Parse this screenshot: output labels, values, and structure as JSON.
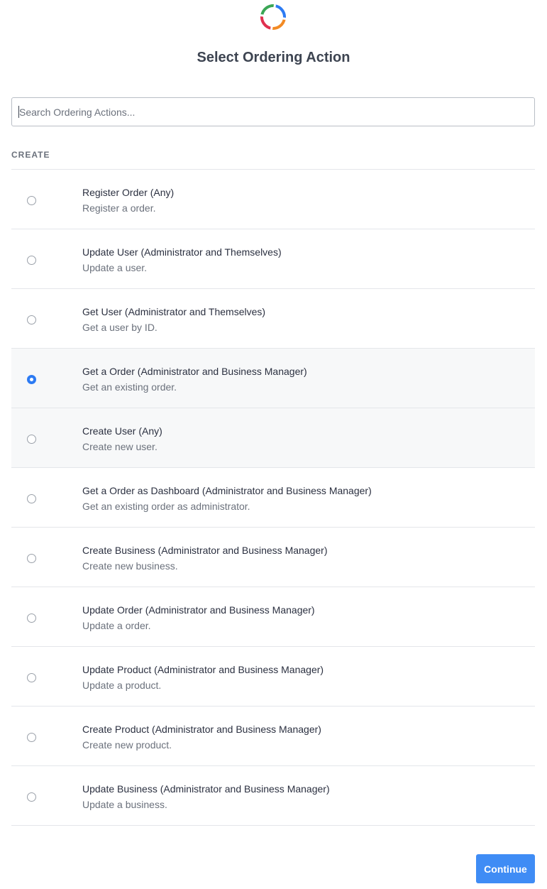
{
  "header": {
    "title": "Select Ordering Action",
    "logo_icon": "circle-segments-logo-icon",
    "logo_colors": [
      "#2d7bf3",
      "#f28a24",
      "#e0304f",
      "#3aa655"
    ]
  },
  "search": {
    "placeholder": "Search Ordering Actions...",
    "value": ""
  },
  "section": {
    "label": "CREATE"
  },
  "actions": [
    {
      "title": "Register Order (Any)",
      "description": "Register a order.",
      "selected": false
    },
    {
      "title": "Update User (Administrator and Themselves)",
      "description": "Update a user.",
      "selected": false
    },
    {
      "title": "Get User (Administrator and Themselves)",
      "description": "Get a user by ID.",
      "selected": false
    },
    {
      "title": "Get a Order (Administrator and Business Manager)",
      "description": "Get an existing order.",
      "selected": true
    },
    {
      "title": "Create User (Any)",
      "description": "Create new user.",
      "selected": false
    },
    {
      "title": "Get a Order as Dashboard (Administrator and Business Manager)",
      "description": "Get an existing order as administrator.",
      "selected": false
    },
    {
      "title": "Create Business (Administrator and Business Manager)",
      "description": "Create new business.",
      "selected": false
    },
    {
      "title": "Update Order (Administrator and Business Manager)",
      "description": "Update a order.",
      "selected": false
    },
    {
      "title": "Update Product (Administrator and Business Manager)",
      "description": "Update a product.",
      "selected": false
    },
    {
      "title": "Create Product (Administrator and Business Manager)",
      "description": "Create new product.",
      "selected": false
    },
    {
      "title": "Update Business (Administrator and Business Manager)",
      "description": "Update a business.",
      "selected": false
    }
  ],
  "footer": {
    "continue_label": "Continue"
  },
  "colors": {
    "accent": "#3f8cf5",
    "selected_row_bg": "#f7f8f9"
  }
}
